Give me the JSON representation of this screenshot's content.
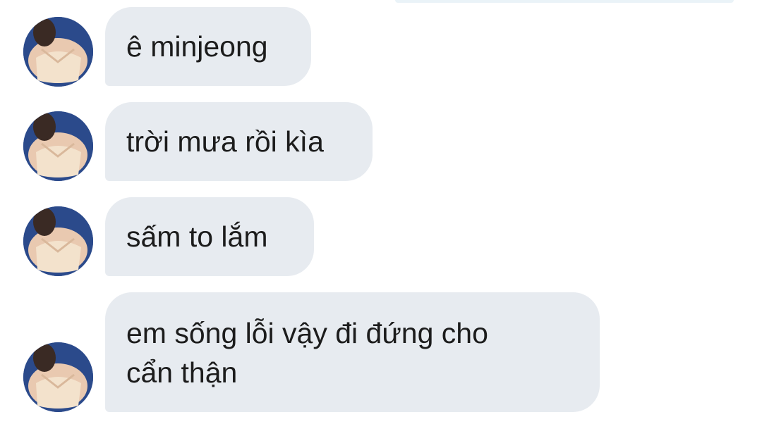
{
  "messages": [
    {
      "text": "ê minjeong"
    },
    {
      "text": "trời mưa rồi kìa"
    },
    {
      "text": "sấm to lắm"
    },
    {
      "text": "em sống lỗi vậy đi đứng cho\ncẩn thận"
    }
  ],
  "colors": {
    "bubble": "#e7ebf0",
    "text": "#1c1c1c",
    "avatar_bg": "#2b4a8b",
    "avatar_top": "#eaf3f8"
  },
  "icons": {
    "avatar": "profile-photo"
  }
}
